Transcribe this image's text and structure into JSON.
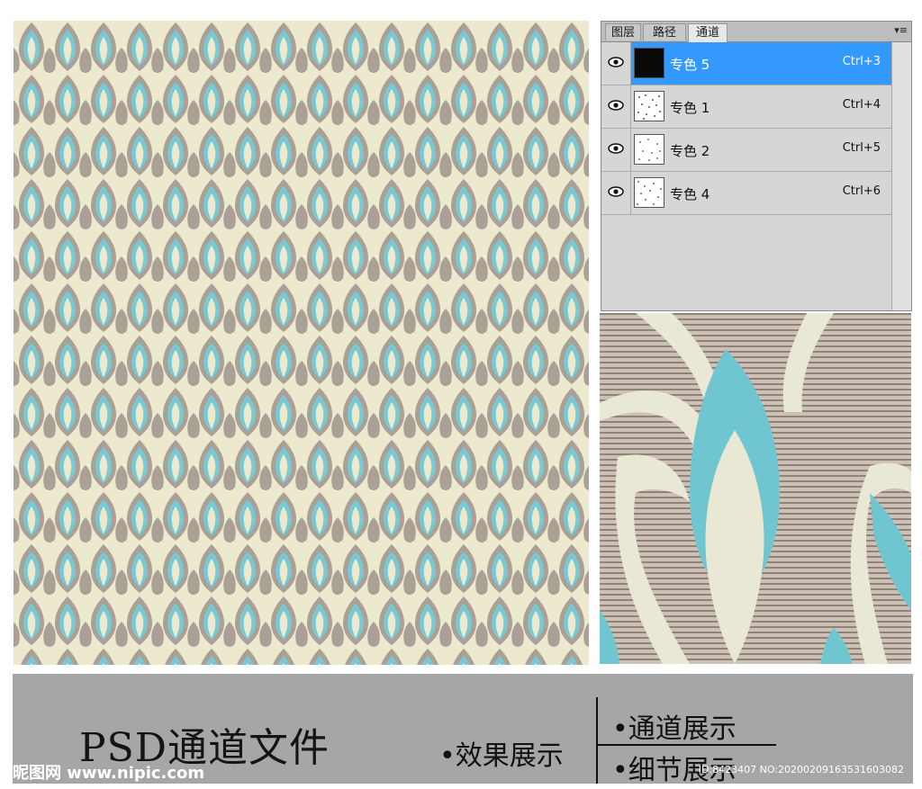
{
  "panel": {
    "tabs": [
      {
        "label": "图层",
        "active": false
      },
      {
        "label": "路径",
        "active": false
      },
      {
        "label": "通道",
        "active": true
      }
    ],
    "menu_icon": "panel-menu-icon",
    "channels": [
      {
        "name": "专色 5",
        "shortcut": "Ctrl+3",
        "selected": true,
        "thumb": "black"
      },
      {
        "name": "专色 1",
        "shortcut": "Ctrl+4",
        "selected": false,
        "thumb": "speckle"
      },
      {
        "name": "专色 2",
        "shortcut": "Ctrl+5",
        "selected": false,
        "thumb": "speckle"
      },
      {
        "name": "专色 4",
        "shortcut": "Ctrl+6",
        "selected": false,
        "thumb": "speckle"
      }
    ]
  },
  "banner": {
    "title": "PSD通道文件",
    "effect_label": "•效果展示",
    "channels_label": "•通道展示",
    "detail_label": "•细节展示",
    "watermark": "昵图网 www.nipic.com",
    "image_id": "ID:8423407 NO:20200209163531603082"
  },
  "colors": {
    "pattern_bg": "#ece9cf",
    "pattern_grey": "#aaa095",
    "pattern_blue": "#78c9d3",
    "selection_blue": "#3399ff",
    "banner_grey": "#a6a6a6"
  }
}
